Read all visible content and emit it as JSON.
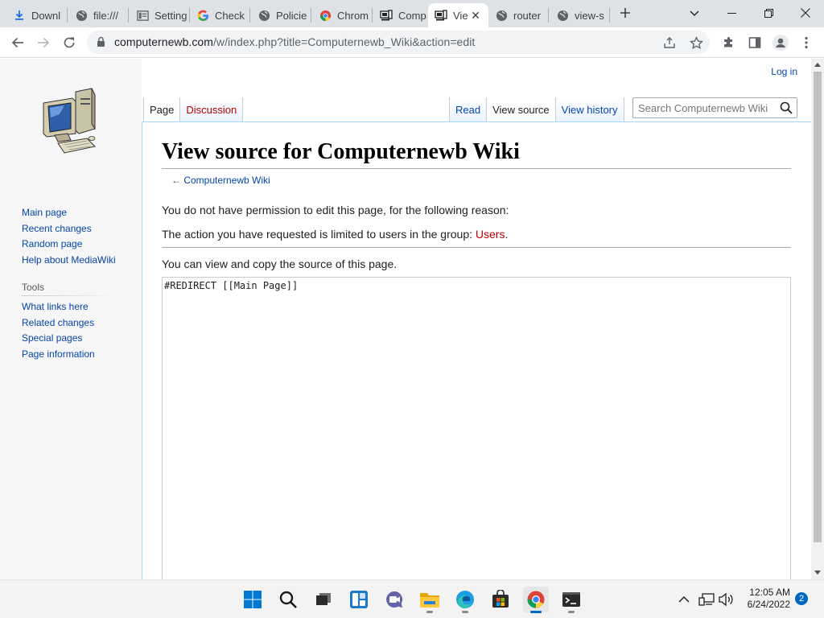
{
  "browser": {
    "tabs": [
      {
        "title": "Downl",
        "icon": "download-icon"
      },
      {
        "title": "file:///",
        "icon": "globe-icon"
      },
      {
        "title": "Setting",
        "icon": "settings-page-icon"
      },
      {
        "title": "Check",
        "icon": "google-icon"
      },
      {
        "title": "Policie",
        "icon": "globe-icon"
      },
      {
        "title": "Chrom",
        "icon": "chrome-icon"
      },
      {
        "title": "Comp",
        "icon": "computernewb-icon"
      },
      {
        "title": "Vie",
        "icon": "computernewb-icon",
        "active": true
      },
      {
        "title": "router",
        "icon": "globe-icon"
      },
      {
        "title": "view-s",
        "icon": "globe-icon"
      }
    ],
    "address": {
      "host": "computernewb.com",
      "path": "/w/index.php?title=Computernewb_Wiki&action=edit"
    }
  },
  "wiki": {
    "login": "Log in",
    "navigation": [
      "Main page",
      "Recent changes",
      "Random page",
      "Help about MediaWiki"
    ],
    "tools_heading": "Tools",
    "tools": [
      "What links here",
      "Related changes",
      "Special pages",
      "Page information"
    ],
    "namespace_tabs": {
      "page": "Page",
      "discussion": "Discussion"
    },
    "view_tabs": {
      "read": "Read",
      "view_source": "View source",
      "view_history": "View history"
    },
    "search_placeholder": "Search Computernewb Wiki",
    "heading": "View source for Computernewb Wiki",
    "backlink_arrow": "←",
    "backlink": "Computernewb Wiki",
    "permission_text": "You do not have permission to edit this page, for the following reason:",
    "reason_text": "The action you have requested is limited to users in the group: ",
    "reason_group": "Users",
    "reason_end": ".",
    "view_copy_text": "You can view and copy the source of this page.",
    "source": "#REDIRECT [[Main Page]]"
  },
  "taskbar": {
    "apps": [
      "start-icon",
      "search-icon",
      "task-view-icon",
      "widgets-icon",
      "teams-chat-icon",
      "file-explorer-icon",
      "edge-icon",
      "store-icon",
      "chrome-icon",
      "terminal-icon"
    ],
    "time": "12:05 AM",
    "date": "6/24/2022",
    "notifications": "2"
  },
  "colors": {
    "link": "#0645ad",
    "new_link": "#ba0000",
    "accent": "#0067c0"
  }
}
